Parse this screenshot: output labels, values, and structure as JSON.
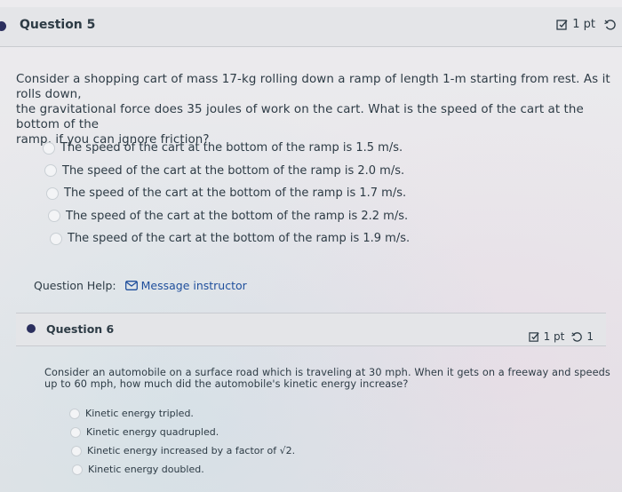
{
  "q5": {
    "title": "Question 5",
    "points": "1 pt",
    "text_lines": [
      "Consider a shopping cart of mass 17-kg rolling down a ramp of length 1-m starting from rest. As it rolls down,",
      "the gravitational force does 35 joules of work on the cart. What is the speed of the cart at the bottom of the",
      "ramp, if you can ignore friction?"
    ],
    "answers": [
      "The speed of the cart at the bottom of the ramp is 1.5 m/s.",
      "The speed of the cart at the bottom of the ramp is 2.0 m/s.",
      "The speed of the cart at the bottom of the ramp is 1.7 m/s.",
      "The speed of the cart at the bottom of the ramp is 2.2 m/s.",
      "The speed of the cart at the bottom of the ramp is 1.9 m/s."
    ],
    "help_label": "Question Help:",
    "help_link": "Message instructor"
  },
  "q6": {
    "title": "Question 6",
    "points": "1 pt",
    "retry_count": "1",
    "text_lines": [
      "Consider an automobile on a surface road which is traveling at 30 mph. When it gets on a freeway and speeds",
      "up to 60 mph, how much did the automobile's kinetic energy increase?"
    ],
    "answers": [
      "Kinetic energy tripled.",
      "Kinetic energy quadrupled.",
      "Kinetic energy increased by a factor of √2.",
      "Kinetic energy doubled."
    ]
  },
  "icons": {
    "bullet_color": "#2b2f5e",
    "link_color": "#1f4f9c"
  }
}
